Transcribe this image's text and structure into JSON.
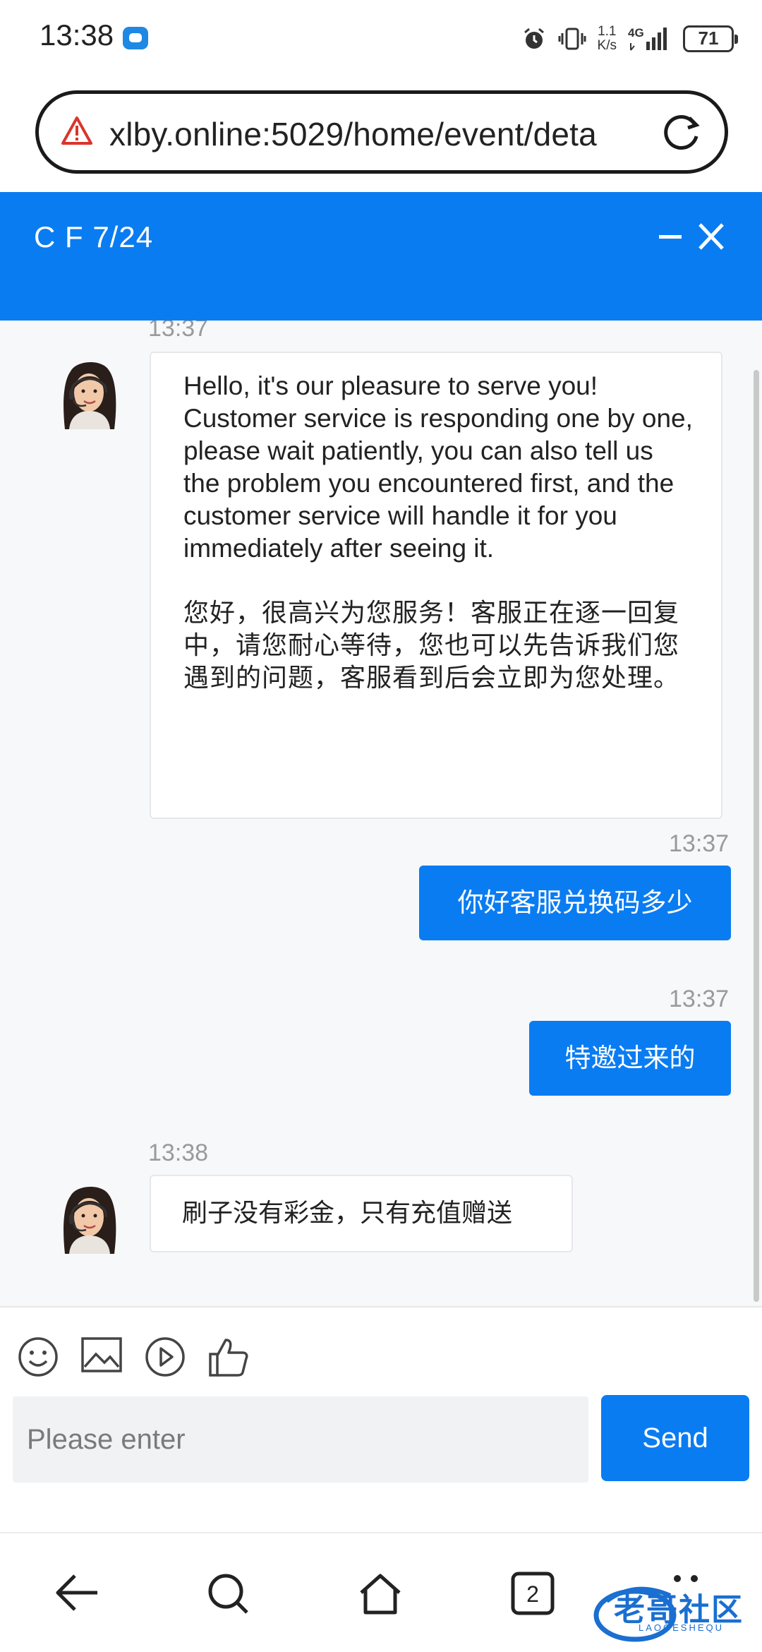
{
  "status_bar": {
    "time": "13:38",
    "net_speed_value": "1.1",
    "net_speed_unit": "K/s",
    "network": "4G",
    "battery": "71"
  },
  "browser": {
    "url": "xlby.online:5029/home/event/deta"
  },
  "chat": {
    "title": "C F 7/24",
    "messages": [
      {
        "time": "13:37",
        "direction": "incoming",
        "paragraphs": [
          "Hello, it's our pleasure to serve you! Customer service is responding one by one, please wait patiently, you can also tell us the problem you encountered first, and the customer service will handle it for you immediately after seeing it.",
          "您好，很高兴为您服务！客服正在逐一回复中，请您耐心等待，您也可以先告诉我们您遇到的问题，客服看到后会立即为您处理。"
        ]
      },
      {
        "time": "13:37",
        "direction": "outgoing",
        "text": "你好客服兑换码多少"
      },
      {
        "time": "13:37",
        "direction": "outgoing",
        "text": "特邀过来的"
      },
      {
        "time": "13:38",
        "direction": "incoming",
        "text": "刷子没有彩金，只有充值赠送"
      }
    ]
  },
  "composer": {
    "placeholder": "Please enter",
    "send_label": "Send",
    "tools": [
      "emoji-icon",
      "image-icon",
      "video-icon",
      "thumbs-up-icon"
    ]
  },
  "watermark": {
    "text": "老哥社区",
    "sub": "LAOGESHEQU"
  },
  "colors": {
    "accent": "#0a7cf2",
    "chat_bg": "#f7f8fa"
  }
}
